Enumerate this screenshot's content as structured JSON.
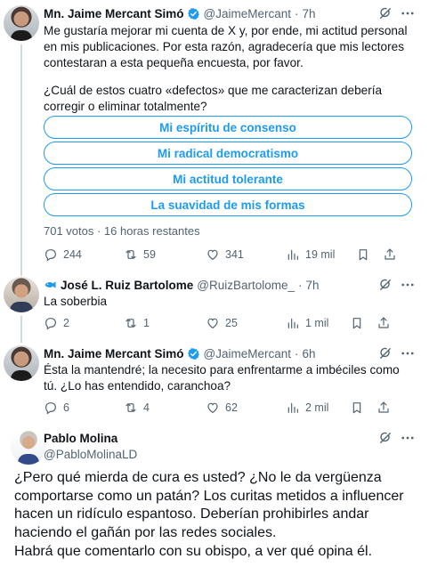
{
  "tweets": [
    {
      "name": "Mn. Jaime Mercant Simó",
      "handle": "@JaimeMercant",
      "time": "7h",
      "text_1": "Me gustaría mejorar mi cuenta de X y, por ende, mi actitud personal en mis publicaciones. Por esta razón, agradecería que mis lectores contestaran a esta pequeña encuesta, por favor.",
      "text_2": "¿Cuál de estos cuatro «defectos» que me caracterizan debería corregir o eliminar totalmente?",
      "poll": {
        "options": [
          "Mi espíritu de consenso",
          "Mi radical democratismo",
          "Mi actitud tolerante",
          "La suavidad de mis formas"
        ],
        "meta": "701 votos · 16 horas restantes"
      },
      "replies": "244",
      "reposts": "59",
      "likes": "341",
      "views": "19 mil"
    },
    {
      "name": "José L. Ruiz Bartolome",
      "handle": "@RuizBartolome_",
      "time": "7h",
      "text": "La soberbia",
      "replies": "2",
      "reposts": "1",
      "likes": "25",
      "views": "1 mil"
    },
    {
      "name": "Mn. Jaime Mercant Simó",
      "handle": "@JaimeMercant",
      "time": "6h",
      "text": "Ésta la mantendré; la necesito para enfrentarme a imbéciles como tú. ¿Lo has entendido, caranchoa?",
      "replies": "6",
      "reposts": "4",
      "likes": "62",
      "views": "2 mil"
    },
    {
      "name": "Pablo Molina",
      "handle": "@PabloMolinaLD",
      "text_1": "¿Pero qué mierda de cura es usted? ¿No le da vergüenza comportarse como un patán? Los curitas metidos a influencer hacen un ridículo espantoso. Deberían prohibirles andar haciendo el gañán por las redes sociales.",
      "text_2": "Habrá que comentarlo con su obispo, a ver qué opina él."
    }
  ],
  "colors": {
    "accent": "#1d9bf0",
    "muted": "#536471",
    "text": "#0f1419",
    "line": "#cfd9de"
  }
}
